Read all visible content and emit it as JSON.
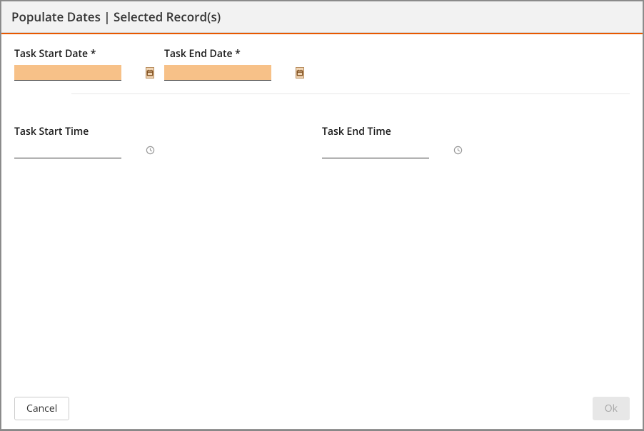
{
  "dialog": {
    "title": "Populate Dates | Selected Record(s)"
  },
  "fields": {
    "startDate": {
      "label": "Task Start Date *",
      "value": ""
    },
    "endDate": {
      "label": "Task End Date *",
      "value": ""
    },
    "startTime": {
      "label": "Task Start Time",
      "value": ""
    },
    "endTime": {
      "label": "Task End Time",
      "value": ""
    }
  },
  "buttons": {
    "cancel": "Cancel",
    "ok": "Ok"
  }
}
